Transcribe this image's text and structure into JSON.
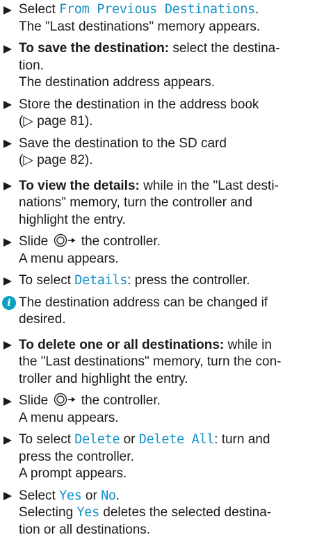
{
  "steps": [
    {
      "pre": "Select ",
      "hl": "From Previous Destinations",
      "post": ".",
      "sub": "The \"Last destinations\" memory appears."
    },
    {
      "bold": "To save the destination:",
      "l1": " select the destina-",
      "l2": "tion.",
      "sub": "The destination address appears."
    },
    {
      "l1": "Store the destination in the address book",
      "l2": "(▷ page 81)."
    },
    {
      "l1": "Save the destination to the SD card",
      "l2": "(▷ page 82)."
    },
    {
      "bold": "To view the details:",
      "l1": " while in the \"Last desti-",
      "l2": "nations\" memory, turn the controller and",
      "l3": "highlight the entry."
    },
    {
      "pre": "Slide ",
      "post": " the controller.",
      "sub": "A menu appears."
    },
    {
      "pre": "To select ",
      "hl": "Details",
      "post": ": press the controller."
    },
    {
      "info_icon": "info-icon",
      "l1": " The destination address can be changed if",
      "l2": "desired."
    },
    {
      "bold": "To delete one or all destinations:",
      "l1": " while in",
      "l2": "the \"Last destinations\" memory, turn the con-",
      "l3": "troller and highlight the entry."
    },
    {
      "pre": "Slide ",
      "post": " the controller.",
      "sub": "A menu appears."
    },
    {
      "pre": "To select ",
      "hl1": "Delete",
      "mid": " or ",
      "hl2": "Delete All",
      "post": ": turn and",
      "l2": "press the controller.",
      "sub": "A prompt appears."
    },
    {
      "pre": "Select ",
      "hl1": "Yes",
      "mid": " or ",
      "hl2": "No",
      "post": ".",
      "sub_pre": "Selecting ",
      "sub_hl": "Yes",
      "sub_post": " deletes the selected destina-",
      "sub_l2": "tion or all destinations."
    }
  ],
  "icons": {
    "bullet": "triangle-bullet-icon",
    "controller_slide": "controller-slide-right-icon",
    "info": "info-icon"
  },
  "colors": {
    "highlight": "#1492c8",
    "info": "#0aa0c2",
    "text": "#1a1a1a"
  }
}
